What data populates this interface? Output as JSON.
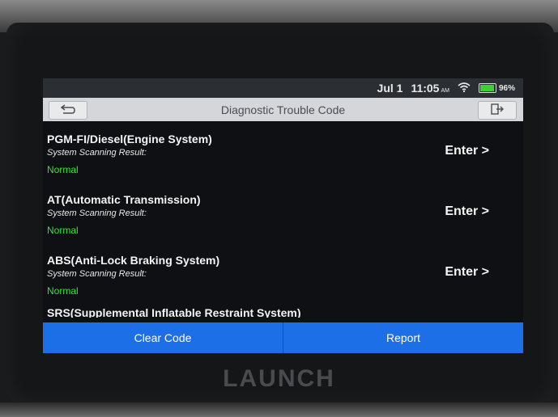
{
  "statusbar": {
    "date": "Jul 1",
    "time": "11:05",
    "ampm": "AM",
    "battery_percent": "96%",
    "battery_level": 0.96,
    "icons": [
      "wifi-icon",
      "battery-icon"
    ]
  },
  "titlebar": {
    "title": "Diagnostic Trouble Code",
    "back_icon": "back-arrow-icon",
    "exit_icon": "exit-icon"
  },
  "systems": [
    {
      "name": "PGM-FI/Diesel(Engine System)",
      "label": "System Scanning Result:",
      "result": "Normal",
      "action": "Enter >"
    },
    {
      "name": "AT(Automatic Transmission)",
      "label": "System Scanning Result:",
      "result": "Normal",
      "action": "Enter >"
    },
    {
      "name": "ABS(Anti-Lock Braking System)",
      "label": "System Scanning Result:",
      "result": "Normal",
      "action": "Enter >"
    },
    {
      "name": "SRS(Supplemental Inflatable Restraint System)"
    }
  ],
  "buttons": {
    "clear_code": "Clear Code",
    "report": "Report"
  },
  "brand": "LAUNCH",
  "colors": {
    "accent_blue": "#1c6fe6",
    "normal_green": "#34e33c",
    "titlebar_bg": "#d4d6d9"
  }
}
